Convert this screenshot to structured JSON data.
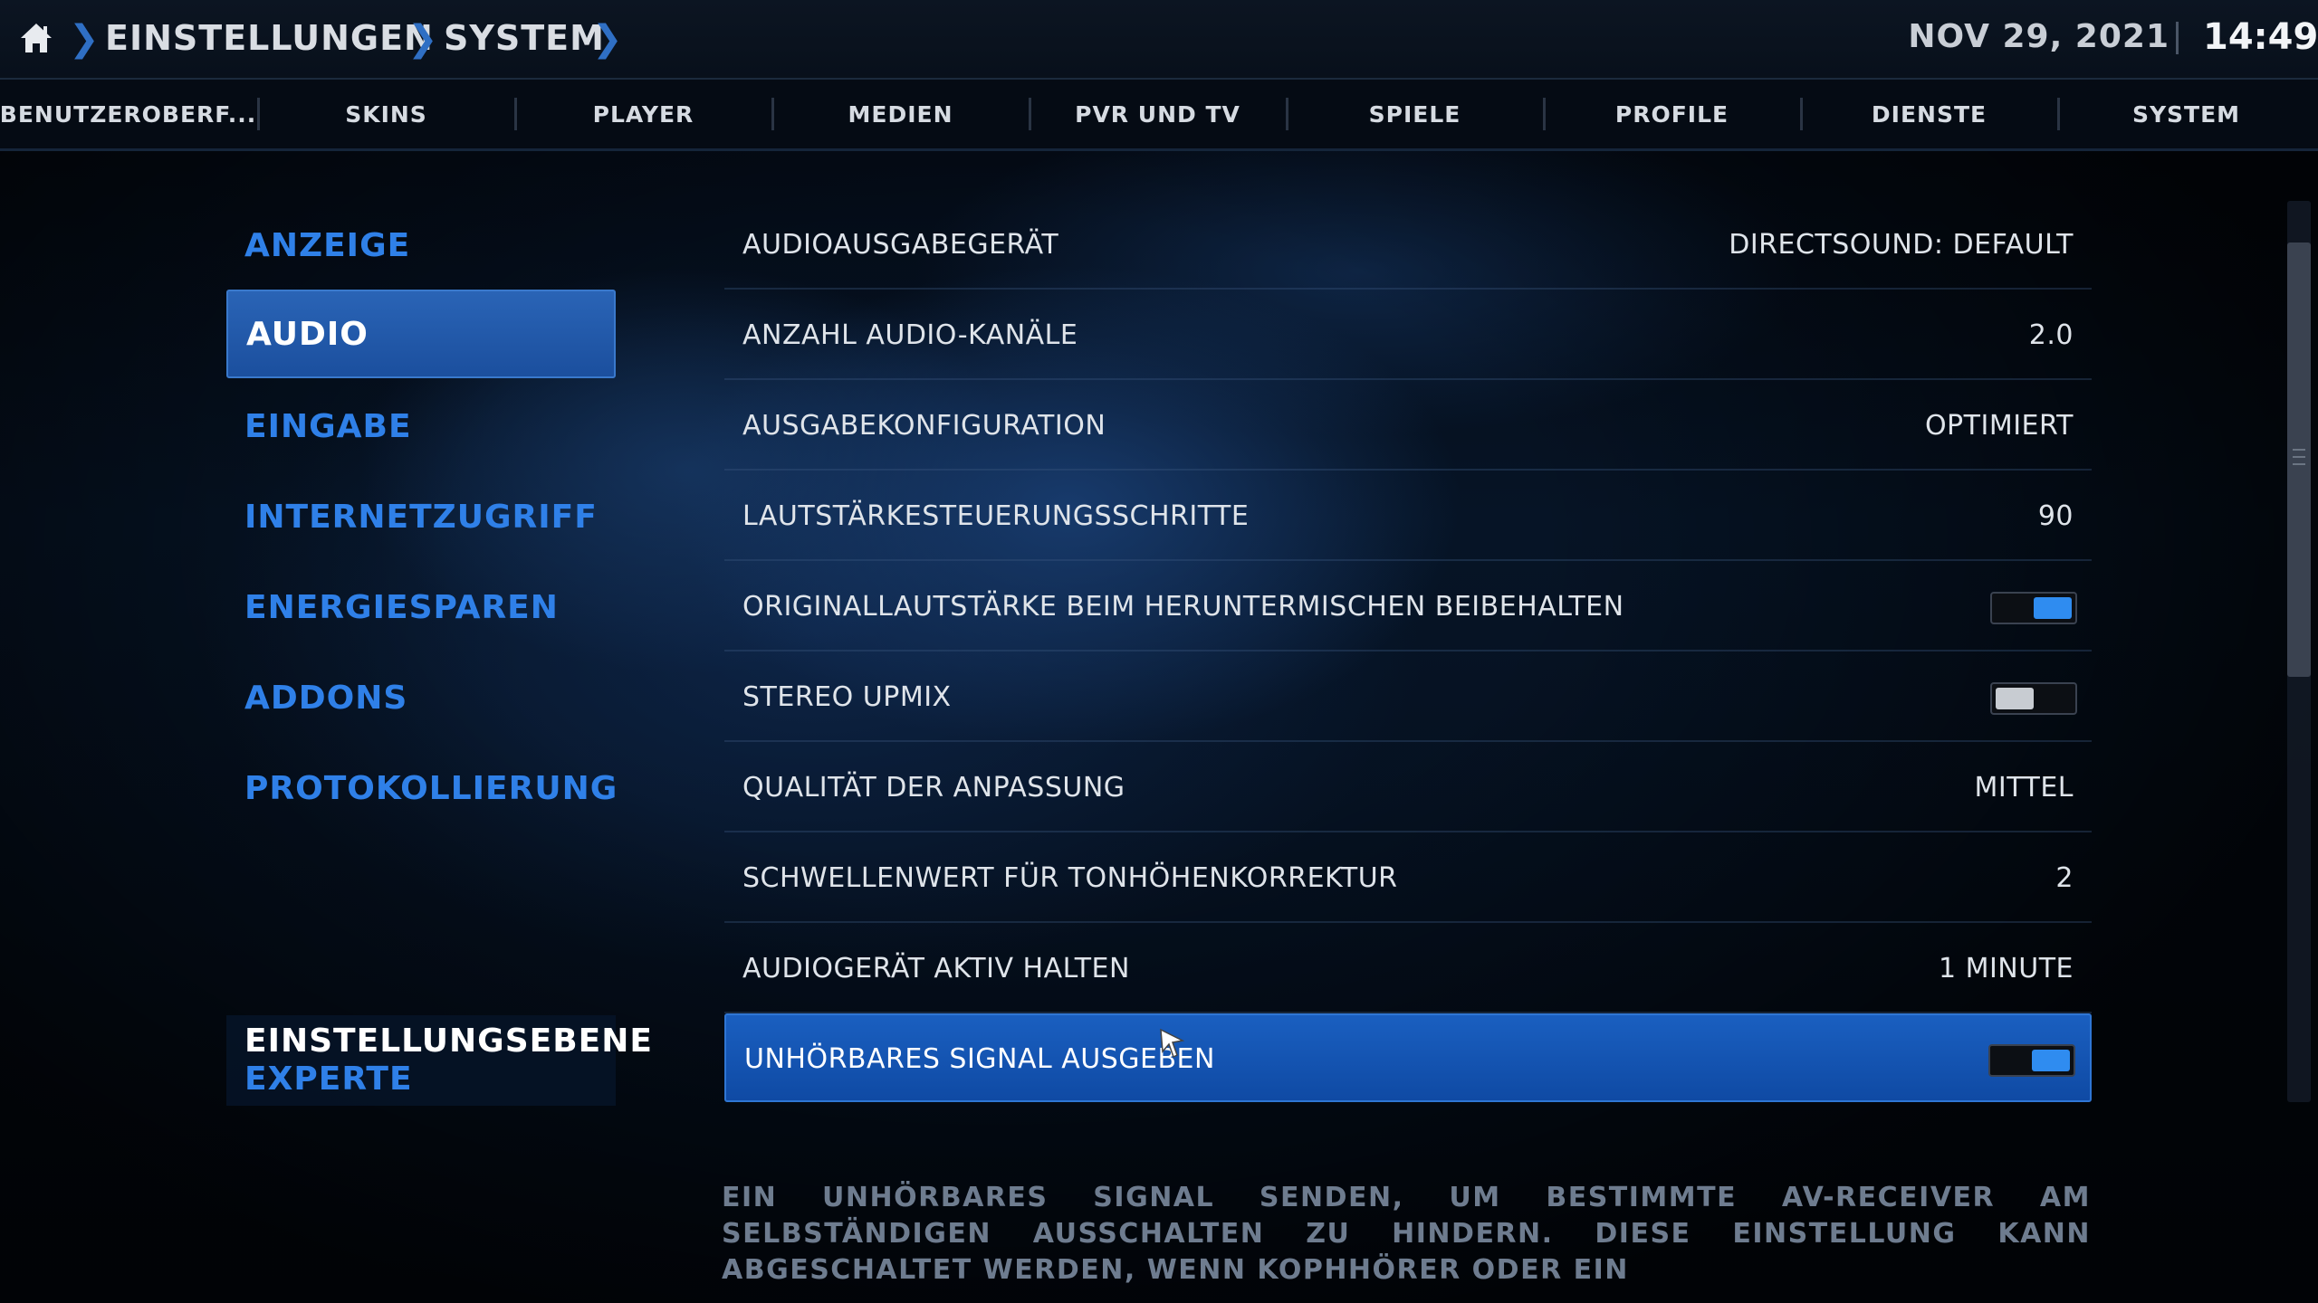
{
  "header": {
    "breadcrumbs": [
      "EINSTELLUNGEN",
      "SYSTEM"
    ],
    "date": "NOV 29, 2021",
    "time": "14:49"
  },
  "tabs": [
    {
      "label": "BENUTZEROBERF..."
    },
    {
      "label": "SKINS"
    },
    {
      "label": "PLAYER"
    },
    {
      "label": "MEDIEN"
    },
    {
      "label": "PVR UND TV"
    },
    {
      "label": "SPIELE"
    },
    {
      "label": "PROFILE"
    },
    {
      "label": "DIENSTE"
    },
    {
      "label": "SYSTEM"
    }
  ],
  "sidebar": {
    "items": [
      {
        "label": "ANZEIGE"
      },
      {
        "label": "AUDIO"
      },
      {
        "label": "EINGABE"
      },
      {
        "label": "INTERNETZUGRIFF"
      },
      {
        "label": "ENERGIESPAREN"
      },
      {
        "label": "ADDONS"
      },
      {
        "label": "PROTOKOLLIERUNG"
      }
    ],
    "selected": "AUDIO",
    "level_title": "EINSTELLUNGSEBENE",
    "level_value": "EXPERTE"
  },
  "settings": [
    {
      "label": "AUDIOAUSGABEGERÄT",
      "value": "DIRECTSOUND: DEFAULT"
    },
    {
      "label": "ANZAHL AUDIO-KANÄLE",
      "value": "2.0"
    },
    {
      "label": "AUSGABEKONFIGURATION",
      "value": "OPTIMIERT"
    },
    {
      "label": "LAUTSTÄRKESTEUERUNGSSCHRITTE",
      "value": "90"
    },
    {
      "label": "ORIGINALLAUTSTÄRKE BEIM HERUNTERMISCHEN BEIBEHALTEN",
      "toggle": "on"
    },
    {
      "label": "STEREO UPMIX",
      "toggle": "off"
    },
    {
      "label": "QUALITÄT DER ANPASSUNG",
      "value": "MITTEL"
    },
    {
      "label": "SCHWELLENWERT FÜR TONHÖHENKORREKTUR",
      "value": "2"
    },
    {
      "label": "AUDIOGERÄT AKTIV HALTEN",
      "value": "1 MINUTE"
    },
    {
      "label": "UNHÖRBARES SIGNAL AUSGEBEN",
      "toggle": "on",
      "focused": true
    }
  ],
  "description": "EIN UNHÖRBARES SIGNAL SENDEN, UM BESTIMMTE AV-RECEIVER AM SELBSTÄNDIGEN AUSSCHALTEN ZU HINDERN. DIESE EINSTELLUNG KANN ABGESCHALTET WERDEN, WENN KOPHHÖRER ODER EIN",
  "icons": {
    "home": "home-icon",
    "breadcrumb_separator": "chevron-right-icon",
    "cursor": "mouse-pointer-icon"
  },
  "colors": {
    "accent": "#2f80e8",
    "focus_bg": "#1a5fc0",
    "toggle_on": "#2f8cf0"
  }
}
